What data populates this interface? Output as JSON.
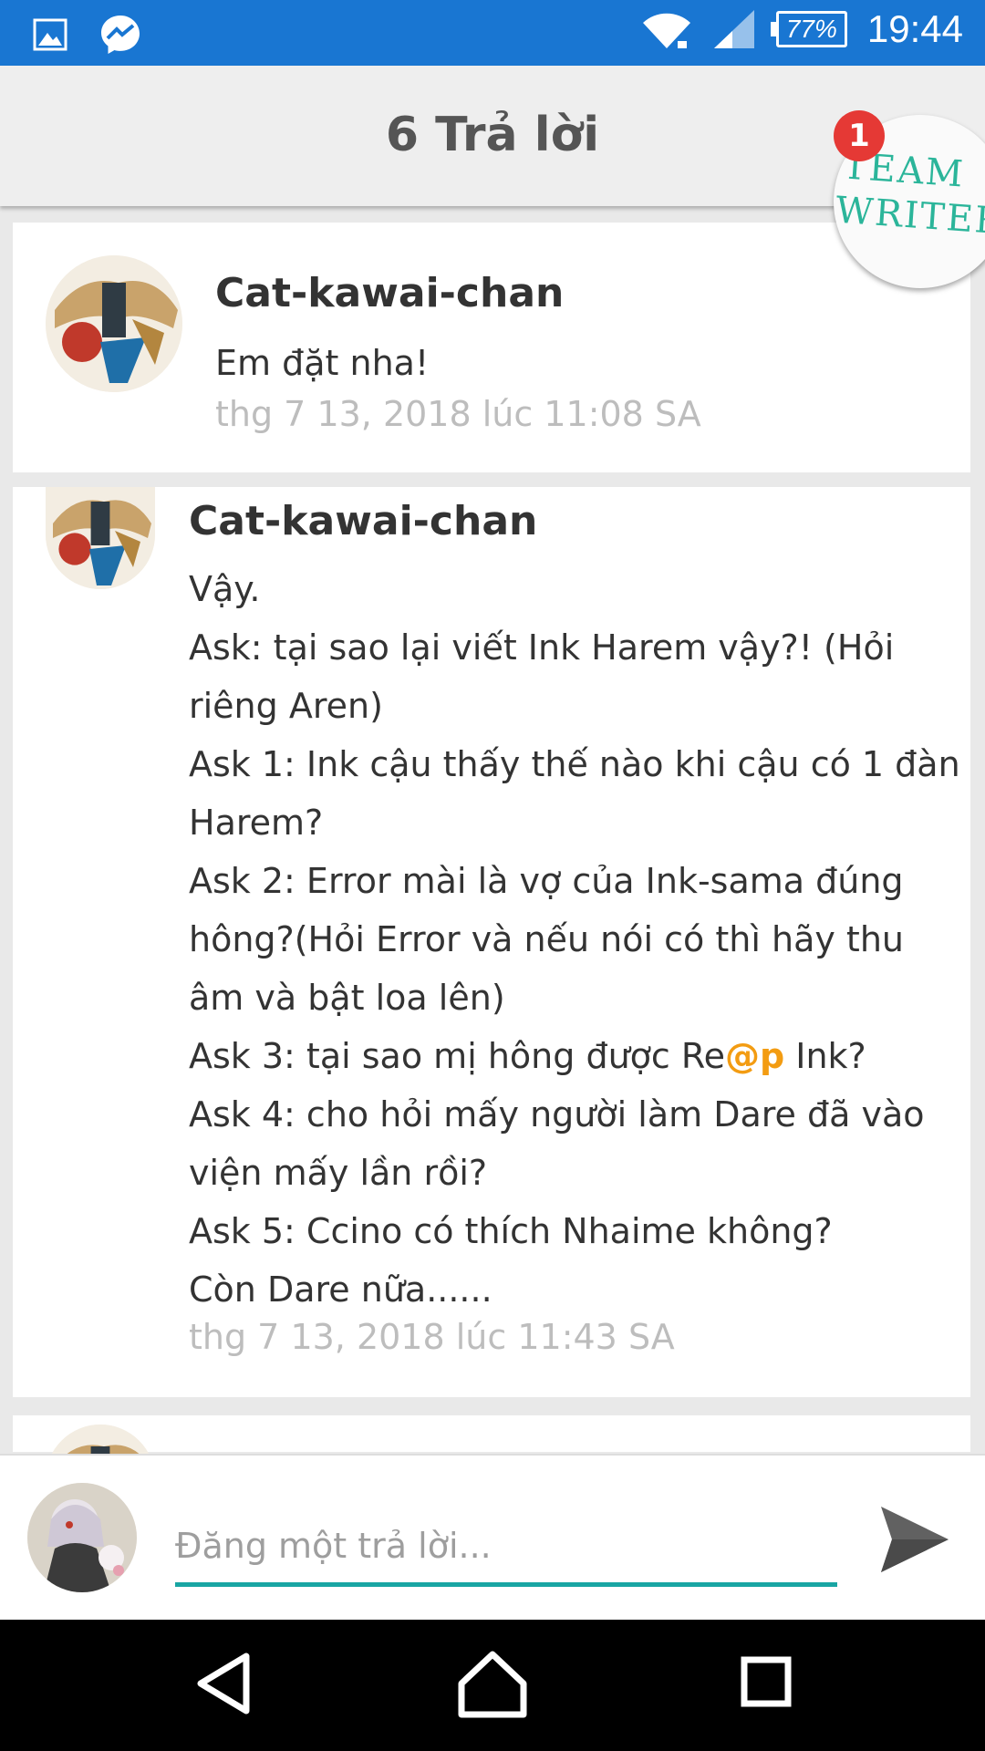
{
  "status_bar": {
    "time": "19:44",
    "battery": "77%",
    "icons": [
      "gallery-icon",
      "messenger-icon",
      "wifi-icon",
      "signal-icon",
      "battery-icon"
    ]
  },
  "header": {
    "title": "6 Trả lời",
    "badge_count": "1",
    "floating_logo_text": [
      "TEAM",
      "WRITER"
    ]
  },
  "comments": [
    {
      "author": "Cat-kawai-chan",
      "lines": [
        "Em đặt nha!"
      ],
      "timestamp": "thg 7 13, 2018 lúc 11:08 SA"
    },
    {
      "author": "Cat-kawai-chan",
      "lines": [
        "Vậy.",
        "Ask: tại sao lại viết Ink Harem vậy?! (Hỏi",
        "riêng Aren)",
        "Ask 1: Ink cậu thấy thế nào khi cậu có 1 đàn",
        "Harem?",
        "Ask 2: Error mài là vợ của Ink-sama đúng",
        "hông?(Hỏi Error và nếu nói có thì hãy thu",
        "âm và bật loa lên)",
        "Ask 3: tại sao mị hông được Re",
        "Ask 4: cho hỏi mấy người làm Dare đã vào",
        "viện mấy lần rồi?",
        "Ask 5: Ccino có thích Nhaime không?",
        "Còn Dare nữa......"
      ],
      "mention": "@p",
      "mention_after": " Ink?",
      "timestamp": "thg 7 13, 2018 lúc 11:43 SA"
    }
  ],
  "reply": {
    "placeholder": "Đăng một trả lời..."
  },
  "colors": {
    "status_bar": "#1976d2",
    "accent_underline": "#19a5a3",
    "mention": "#f39c12",
    "badge": "#e53935"
  }
}
